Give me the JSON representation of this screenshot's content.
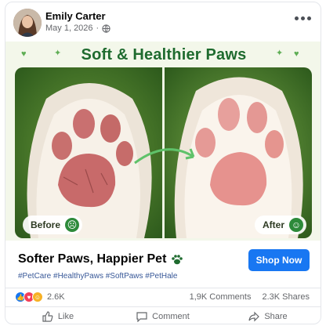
{
  "post": {
    "author": "Emily Carter",
    "date": "May 1, 2026"
  },
  "media": {
    "headline": "Soft & Healthier Paws",
    "before_label": "Before",
    "after_label": "After",
    "before_face": "☹",
    "after_face": "☺"
  },
  "ad": {
    "title": "Softer Paws, Happier Pet",
    "hashtags": "#PetCare #HealthyPaws #SoftPaws #PetHale",
    "cta": "Shop Now"
  },
  "stats": {
    "reaction_count": "2.6K",
    "comments": "1,9K Comments",
    "shares": "2.3K Shares"
  },
  "actions": {
    "like": "Like",
    "comment": "Comment",
    "share": "Share"
  },
  "colors": {
    "accent": "#1877f2",
    "headline_green": "#1f6b2f",
    "background_tint": "#f3f7ea"
  },
  "icons": [
    "globe-icon",
    "more-options-icon",
    "paw-icon",
    "like-reaction-icon",
    "love-reaction-icon",
    "haha-reaction-icon",
    "thumbs-up-icon",
    "comment-icon",
    "share-icon"
  ]
}
